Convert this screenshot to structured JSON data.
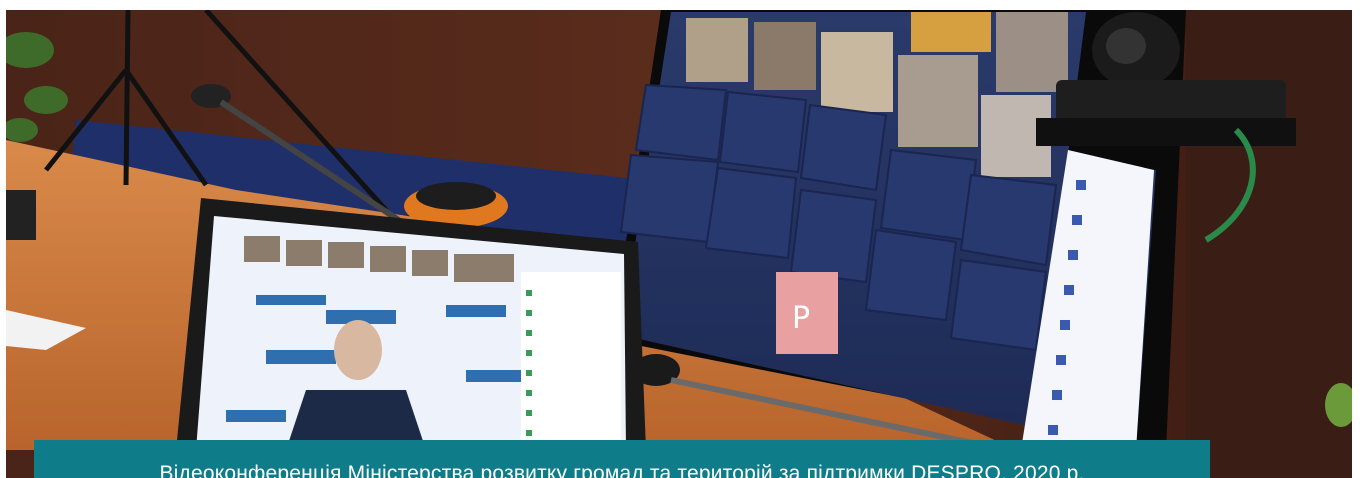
{
  "photo": {
    "subject": "video-conference-room-photo"
  },
  "caption": {
    "text": "Відеоконференція Міністерства розвитку громад та територій за підтримки DESPRO, 2020 р.",
    "background_color": "#0f7c8a",
    "text_color": "#ffffff"
  }
}
